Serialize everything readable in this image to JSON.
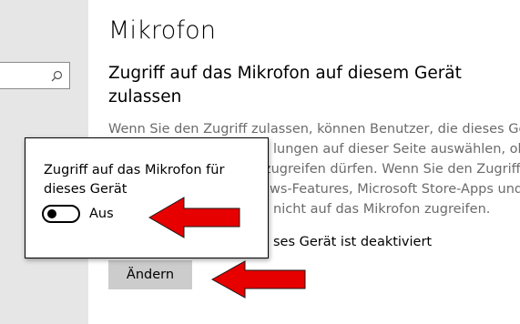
{
  "search": {
    "icon": "search-icon"
  },
  "page": {
    "title": "Mikrofon",
    "subtitle": "Zugriff auf das Mikrofon auf diesem Gerät zulassen",
    "description_lines": [
      "Wenn Sie den Zugriff zulassen, können Benutzer, die dieses Gerät",
      "lungen auf dieser Seite auswählen, ob",
      "zugreifen dürfen. Wenn Sie den Zugriff",
      "ws-Features, Microsoft Store-Apps und",
      "nicht auf das Mikrofon zugreifen."
    ],
    "status_text": "ses Gerät ist deaktiviert",
    "change_button": "Ändern"
  },
  "popup": {
    "label": "Zugriff auf das Mikrofon für dieses Gerät",
    "toggle_state": "Aus",
    "toggle_on": false
  },
  "colors": {
    "arrow": "#e60000",
    "sidebar": "#e6e6e6",
    "button": "#cccccc",
    "description": "#6b6b6b"
  }
}
